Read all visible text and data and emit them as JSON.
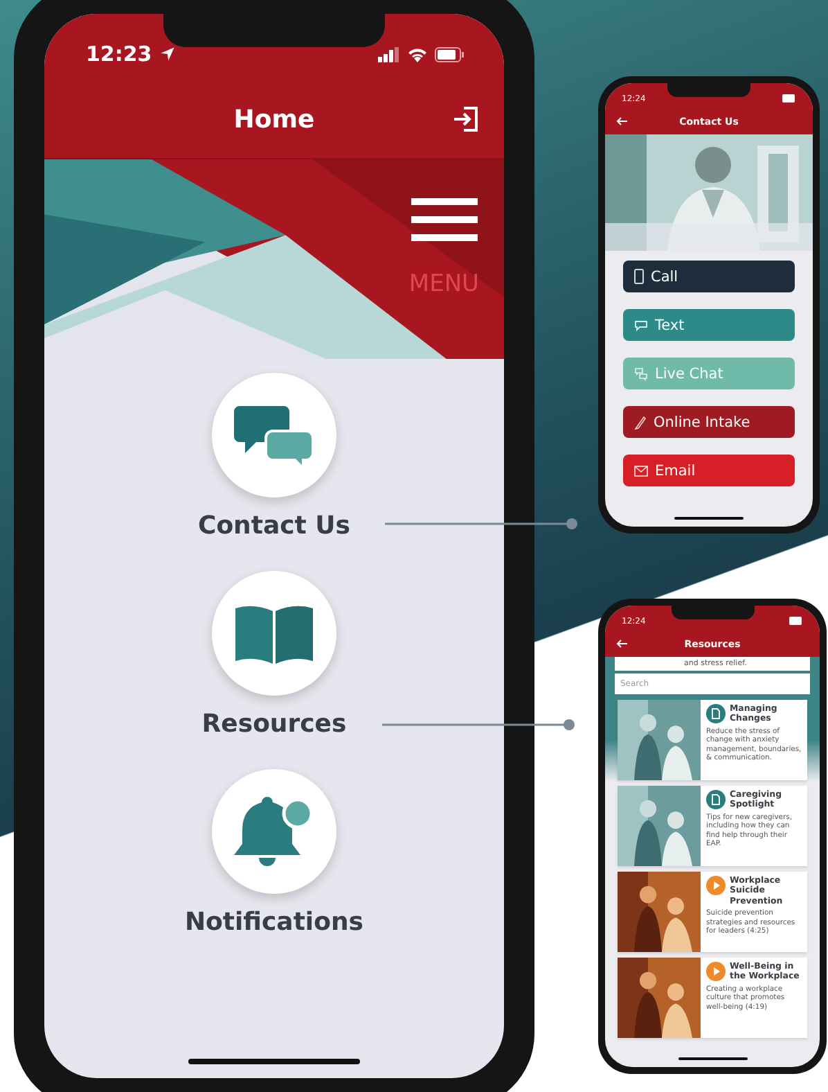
{
  "home_phone": {
    "status_time": "12:23",
    "title": "Home",
    "menu_label": "MENU",
    "items": [
      {
        "label": "Contact Us",
        "kind": "chat"
      },
      {
        "label": "Resources",
        "kind": "book"
      },
      {
        "label": "Notifications",
        "kind": "bell"
      }
    ]
  },
  "contact_phone": {
    "status_time": "12:24",
    "title": "Contact Us",
    "buttons": [
      {
        "label": "Call",
        "kind": "phone",
        "color": "#1f2c3b"
      },
      {
        "label": "Text",
        "kind": "text",
        "color": "#2c8a88"
      },
      {
        "label": "Live Chat",
        "kind": "chat",
        "color": "#6fbaa9"
      },
      {
        "label": "Online Intake",
        "kind": "intake",
        "color": "#9e1b22"
      },
      {
        "label": "Email",
        "kind": "email",
        "color": "#d61f26"
      }
    ]
  },
  "resources_phone": {
    "status_time": "12:24",
    "title": "Resources",
    "partial_text": "and stress relief.",
    "search": {
      "placeholder": "Search"
    },
    "cards": [
      {
        "title": "Managing Changes",
        "description": "Reduce the stress of change with anxiety management, boundaries, & communication.",
        "kind": "article"
      },
      {
        "title": "Caregiving Spotlight",
        "description": "Tips for new caregivers, including how they can find help through their EAP.",
        "kind": "article"
      },
      {
        "title": "Workplace Suicide Prevention",
        "description": "Suicide prevention strategies and resources for leaders (4:25)",
        "kind": "video"
      },
      {
        "title": "Well-Being in the Workplace",
        "description": "Creating a workplace culture that promotes well-being (4:19)",
        "kind": "video"
      }
    ]
  }
}
